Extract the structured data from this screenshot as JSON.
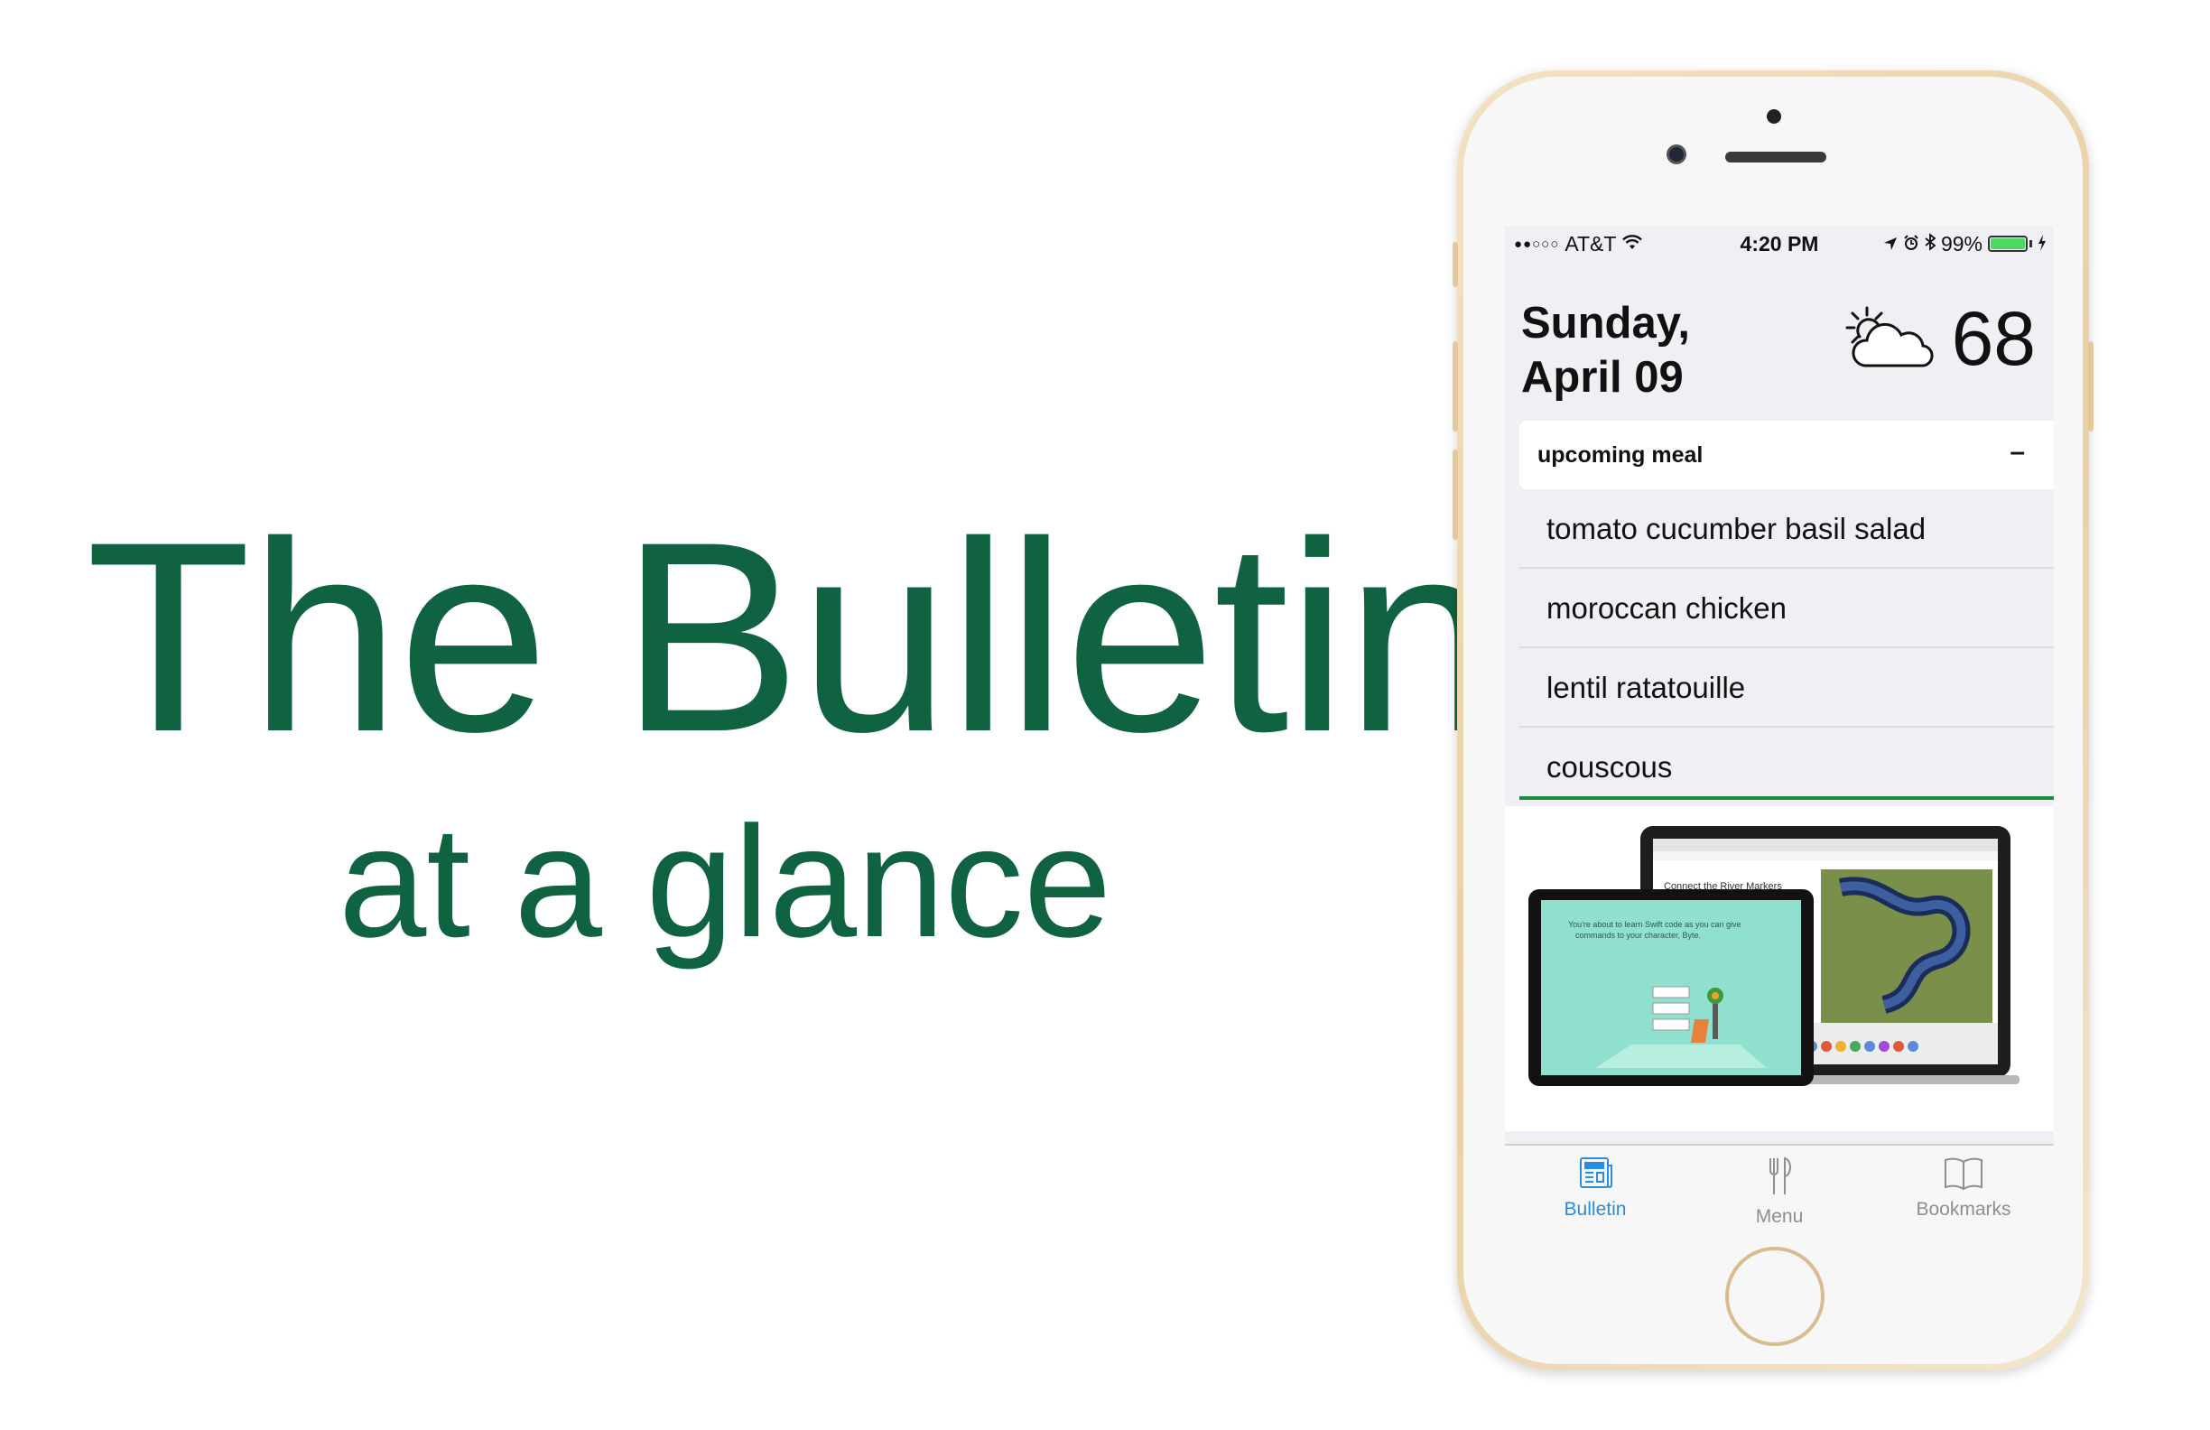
{
  "hero": {
    "title": "The Bulletin",
    "subtitle": "at a glance"
  },
  "colors": {
    "brand": "#0f6340",
    "accent_line": "#1a8a3c",
    "tab_active": "#2a8be0",
    "tab_inactive": "#8e8e93"
  },
  "status_bar": {
    "signal": "●●○○○",
    "carrier": "AT&T",
    "time": "4:20 PM",
    "battery_percent": "99%",
    "battery_level": 0.99,
    "icons": [
      "wifi-icon",
      "location-arrow-icon",
      "alarm-icon",
      "bluetooth-icon",
      "battery-icon",
      "charging-icon"
    ]
  },
  "header": {
    "date_line1": "Sunday,",
    "date_line2": "April 09",
    "weather_icon": "partly-cloudy-icon",
    "temperature": "68"
  },
  "meal": {
    "label": "upcoming meal",
    "toggle": "–",
    "items": [
      "tomato cucumber basil salad",
      "moroccan chicken",
      "lentil ratatouille",
      "couscous"
    ]
  },
  "promo": {
    "mac_heading": "Connect the River Markers",
    "ipad_text": "You're about to learn Swift code as you can give commands to your character, Byte."
  },
  "tabs": [
    {
      "label": "Bulletin",
      "icon": "newspaper-icon",
      "active": true
    },
    {
      "label": "Menu",
      "icon": "fork-knife-icon",
      "active": false
    },
    {
      "label": "Bookmarks",
      "icon": "book-icon",
      "active": false
    }
  ]
}
